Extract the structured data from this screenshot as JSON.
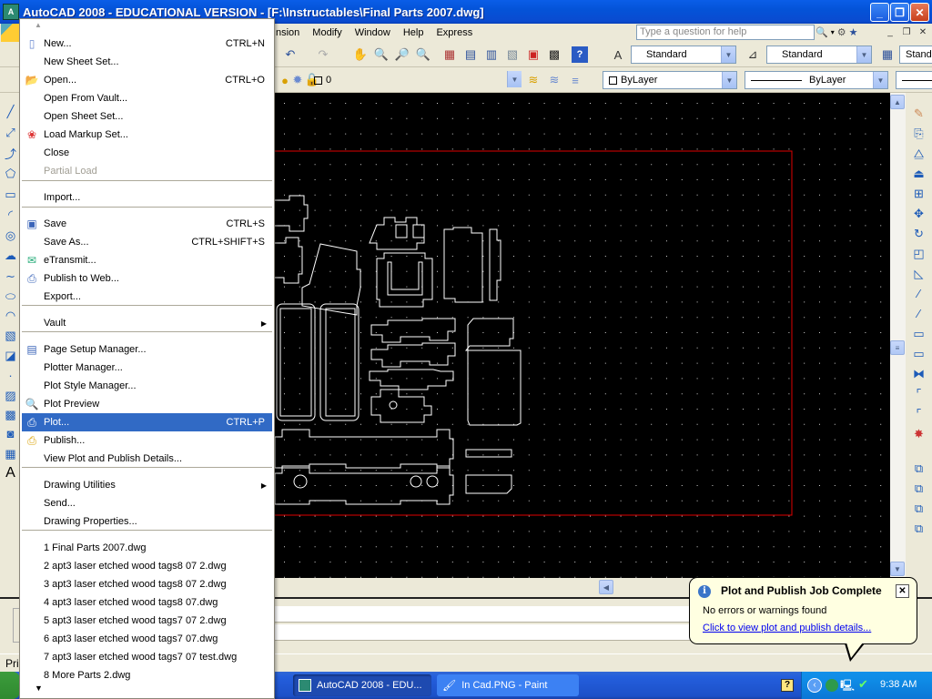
{
  "window": {
    "title": "AutoCAD 2008 - EDUCATIONAL VERSION - [F:\\Instructables\\Final Parts 2007.dwg]",
    "app_icon": "autocad-icon",
    "controls": [
      "minimize",
      "restore",
      "close"
    ]
  },
  "menubar": {
    "items": [
      "Dimension",
      "Modify",
      "Window",
      "Help",
      "Express"
    ],
    "visible_items": [
      "nsion",
      "Modify",
      "Window",
      "Help",
      "Express"
    ],
    "help_placeholder": "Type a question for help"
  },
  "toolbars": {
    "text_style": "Standard",
    "dim_style": "Standard",
    "table_style": "Standa",
    "layer": "0",
    "color": "ByLayer",
    "linetype": "ByLayer"
  },
  "file_menu": {
    "items": [
      {
        "label": "New...",
        "shortcut": "CTRL+N",
        "icon": "new-file-icon"
      },
      {
        "label": "New Sheet Set...",
        "shortcut": ""
      },
      {
        "label": "Open...",
        "shortcut": "CTRL+O",
        "icon": "open-folder-icon"
      },
      {
        "label": "Open From Vault...",
        "shortcut": ""
      },
      {
        "label": "Open Sheet Set...",
        "shortcut": ""
      },
      {
        "label": "Load Markup Set...",
        "shortcut": "",
        "icon": "markup-icon"
      },
      {
        "label": "Close",
        "shortcut": ""
      },
      {
        "label": "Partial Load",
        "shortcut": "",
        "disabled": true
      },
      {
        "label": "Import...",
        "shortcut": ""
      },
      {
        "label": "Save",
        "shortcut": "CTRL+S",
        "icon": "save-icon"
      },
      {
        "label": "Save As...",
        "shortcut": "CTRL+SHIFT+S"
      },
      {
        "label": "eTransmit...",
        "shortcut": "",
        "icon": "etransmit-icon"
      },
      {
        "label": "Publish to Web...",
        "shortcut": "",
        "icon": "publish-web-icon"
      },
      {
        "label": "Export...",
        "shortcut": ""
      },
      {
        "label": "Vault",
        "shortcut": "",
        "submenu": true
      },
      {
        "label": "Page Setup Manager...",
        "shortcut": "",
        "icon": "page-setup-icon"
      },
      {
        "label": "Plotter Manager...",
        "shortcut": ""
      },
      {
        "label": "Plot Style Manager...",
        "shortcut": ""
      },
      {
        "label": "Plot Preview",
        "shortcut": "",
        "icon": "plot-preview-icon"
      },
      {
        "label": "Plot...",
        "shortcut": "CTRL+P",
        "icon": "plot-icon",
        "highlighted": true
      },
      {
        "label": "Publish...",
        "shortcut": "",
        "icon": "publish-icon"
      },
      {
        "label": "View Plot and Publish Details...",
        "shortcut": ""
      },
      {
        "label": "Drawing Utilities",
        "shortcut": "",
        "submenu": true
      },
      {
        "label": "Send...",
        "shortcut": ""
      },
      {
        "label": "Drawing Properties...",
        "shortcut": ""
      },
      {
        "label": "1 Final Parts 2007.dwg",
        "shortcut": ""
      },
      {
        "label": "2 apt3 laser etched wood tags8 07 2.dwg",
        "shortcut": ""
      },
      {
        "label": "3 apt3 laser etched wood tags8 07 2.dwg",
        "shortcut": ""
      },
      {
        "label": "4 apt3 laser etched wood tags8 07.dwg",
        "shortcut": ""
      },
      {
        "label": "5 apt3 laser etched wood tags7 07 2.dwg",
        "shortcut": ""
      },
      {
        "label": "6 apt3 laser etched wood tags7 07.dwg",
        "shortcut": ""
      },
      {
        "label": "7 apt3 laser etched wood tags7 07 test.dwg",
        "shortcut": ""
      },
      {
        "label": "8 More Parts 2.dwg",
        "shortcut": ""
      }
    ]
  },
  "notification": {
    "title": "Plot and Publish Job Complete",
    "message": "No errors or warnings found",
    "link": "Click to view plot and publish details..."
  },
  "statusbar": {
    "text": "Pri"
  },
  "taskbar": {
    "tasks": [
      {
        "label": "AutoCAD 2008 - EDU...",
        "active": true
      },
      {
        "label": "In Cad.PNG - Paint",
        "active": false
      }
    ],
    "clock": "9:38 AM"
  },
  "colors": {
    "canvas_bg": "#000000",
    "drawing_border": "#e00000",
    "menu_highlight": "#316ac5",
    "title_bar": "#0a5ee8",
    "balloon_bg": "#ffffe1"
  }
}
